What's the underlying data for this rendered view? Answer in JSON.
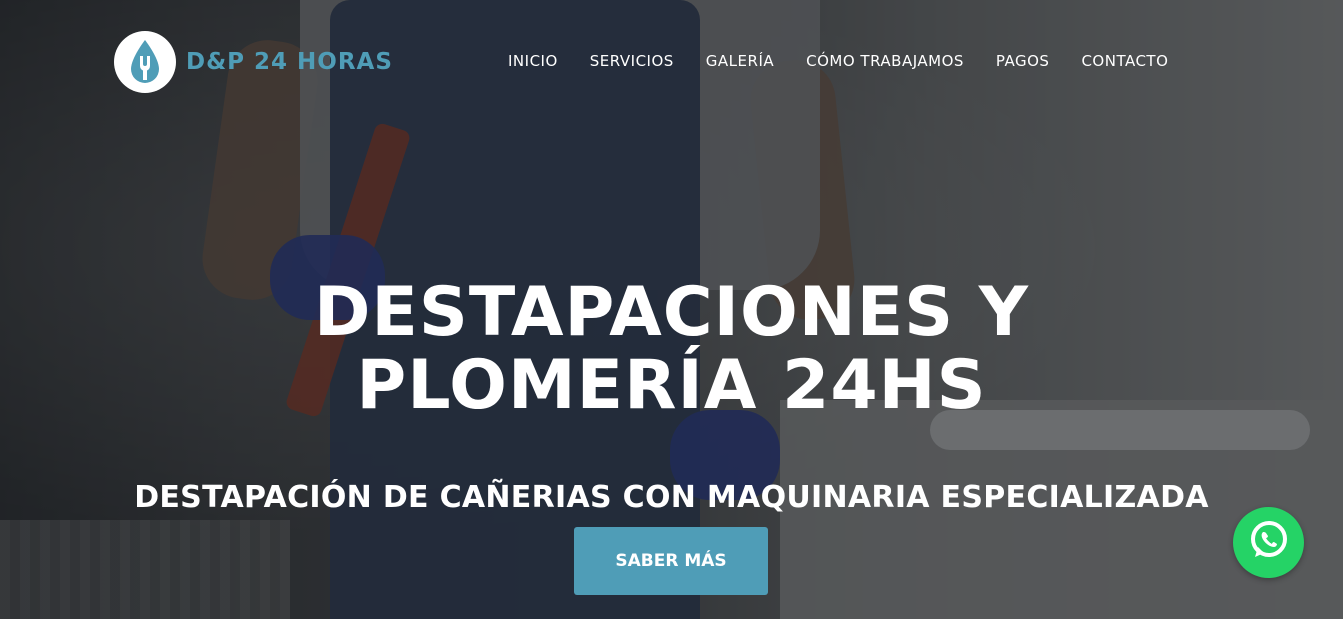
{
  "brand": {
    "name": "D&P 24 HORAS",
    "accent_color": "#4f9db7",
    "logo_icon": "wrench-water-drop-icon"
  },
  "nav": {
    "items": [
      {
        "label": "INICIO"
      },
      {
        "label": "SERVICIOS"
      },
      {
        "label": "GALERÍA"
      },
      {
        "label": "CÓMO TRABAJAMOS"
      },
      {
        "label": "PAGOS"
      },
      {
        "label": "CONTACTO"
      }
    ]
  },
  "hero": {
    "title_line1": "DESTAPACIONES Y",
    "title_line2": "PLOMERÍA 24HS",
    "subtitle": "DESTAPACIÓN DE CAÑERIAS CON MAQUINARIA ESPECIALIZADA",
    "cta_label": "SABER MÁS"
  },
  "floating": {
    "whatsapp_icon": "whatsapp-icon",
    "whatsapp_color": "#25d366"
  }
}
